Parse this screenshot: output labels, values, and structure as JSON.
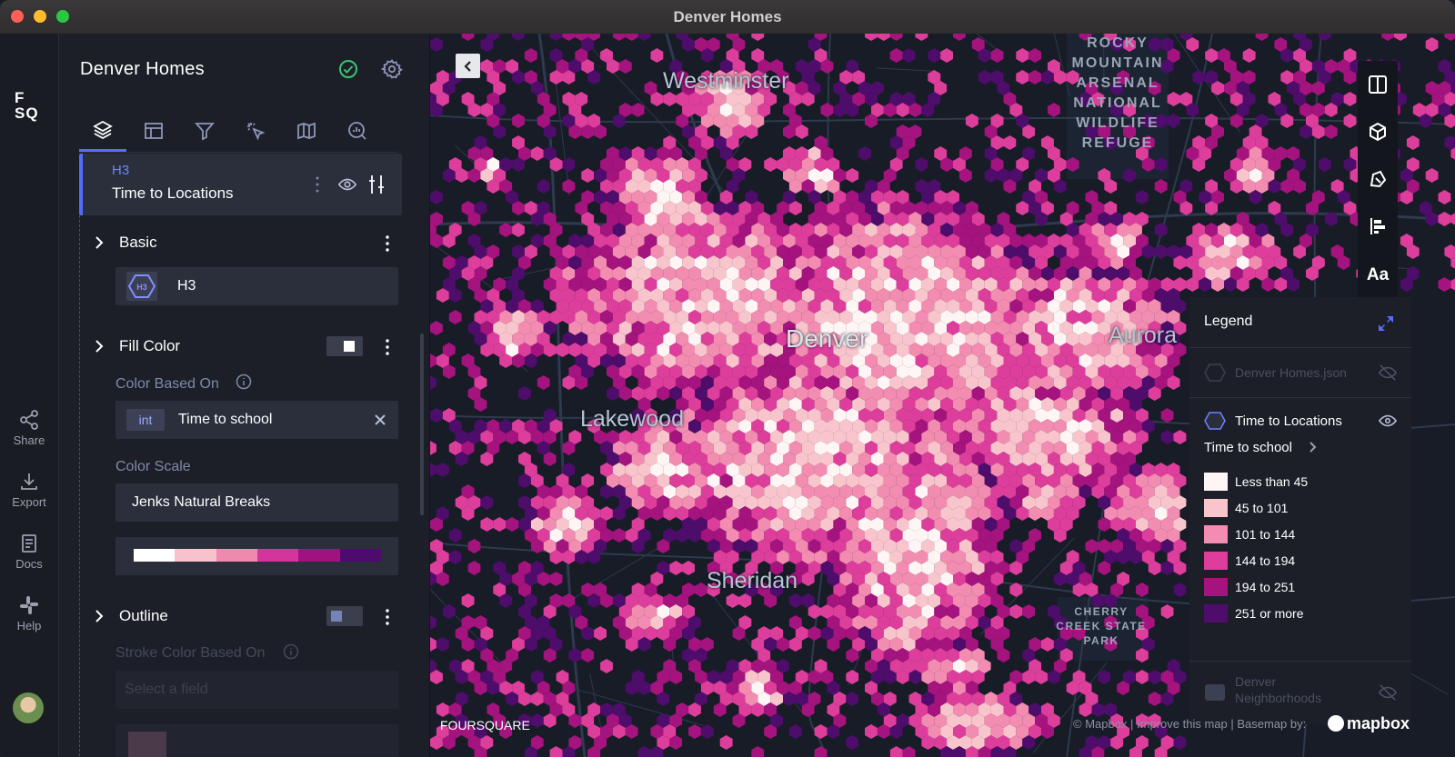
{
  "window": {
    "title": "Denver Homes"
  },
  "rail": {
    "logo_line1": "F",
    "logo_line2": "SQ",
    "items": [
      {
        "label": "Share",
        "icon": "share-icon"
      },
      {
        "label": "Export",
        "icon": "download-icon"
      },
      {
        "label": "Docs",
        "icon": "docs-icon"
      },
      {
        "label": "Help",
        "icon": "slack-icon"
      }
    ]
  },
  "panel": {
    "title": "Denver Homes",
    "tabs": [
      "layers",
      "interactions",
      "filters",
      "effects",
      "base-map",
      "analysis"
    ],
    "layer": {
      "type": "H3",
      "name": "Time to Locations"
    },
    "basic": {
      "label": "Basic",
      "layer_type": "H3",
      "chip": "H3"
    },
    "fill": {
      "label": "Fill Color",
      "color_based_on_label": "Color Based On",
      "field_type": "int",
      "field_name": "Time to school",
      "color_scale_label": "Color Scale",
      "color_scale_value": "Jenks Natural Breaks",
      "ramp": [
        "#ffffff",
        "#f7c2cc",
        "#ef8aae",
        "#d4359c",
        "#a0137f",
        "#4c0b6d"
      ]
    },
    "outline": {
      "label": "Outline",
      "stroke_label": "Stroke Color Based On",
      "stroke_placeholder": "Select a field"
    }
  },
  "map": {
    "cities": [
      "Westminster",
      "Denver",
      "Aurora",
      "Lakewood",
      "Sheridan"
    ],
    "refuge": [
      "ROCKY",
      "MOUNTAIN",
      "ARSENAL",
      "NATIONAL",
      "WILDLIFE",
      "REFUGE"
    ],
    "cherry": [
      "CHERRY",
      "CREEK STATE",
      "PARK"
    ],
    "controls": [
      "split-map",
      "3d",
      "draw",
      "legend",
      "labels"
    ],
    "labels_button": "Aa",
    "foursquare": "FOURSQUARE",
    "attribution": "© Mapbox | Improve this map | Basemap by:",
    "mapbox": "mapbox"
  },
  "legend": {
    "title": "Legend",
    "dataset1": "Denver Homes.json",
    "layer_name": "Time to Locations",
    "field": "Time to school",
    "items": [
      {
        "label": "Less than 45",
        "color": "#fff5f5"
      },
      {
        "label": "45 to 101",
        "color": "#f9c5cd"
      },
      {
        "label": "101 to 144",
        "color": "#f28cb1"
      },
      {
        "label": "144 to 194",
        "color": "#dd3e9c"
      },
      {
        "label": "194 to 251",
        "color": "#a5137e"
      },
      {
        "label": "251 or more",
        "color": "#4e0d6b"
      }
    ],
    "dataset2_line1": "Denver",
    "dataset2_line2": "Neighborhoods"
  }
}
